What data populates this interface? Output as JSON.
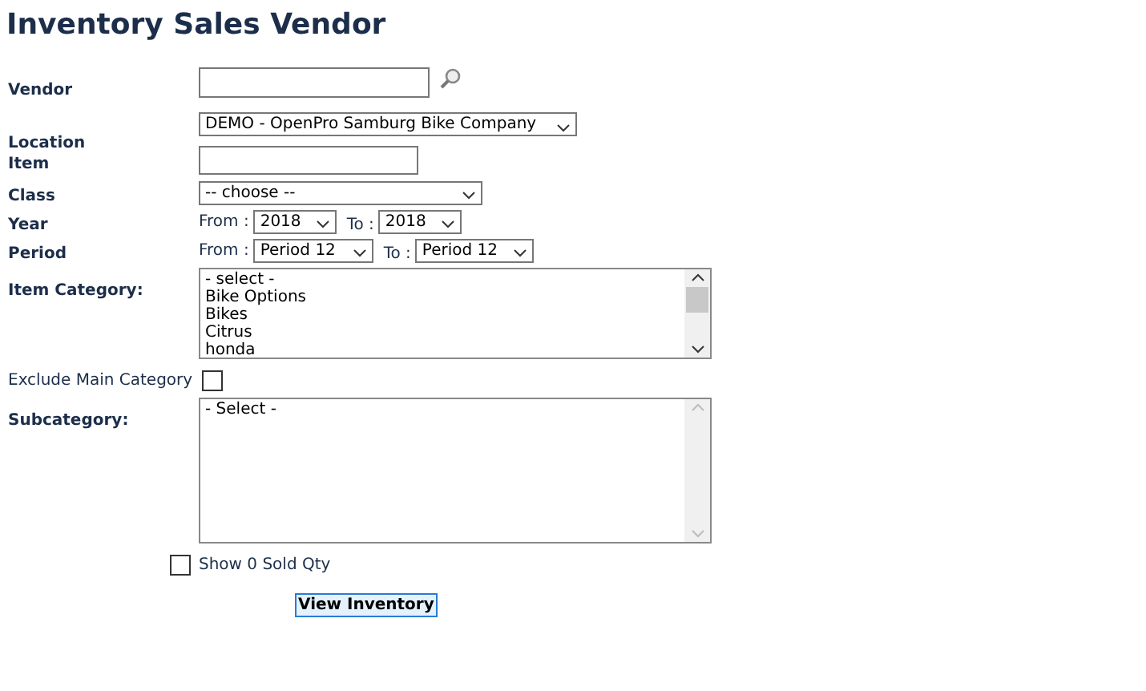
{
  "title": "Inventory Sales Vendor",
  "vendor": {
    "label": "Vendor"
  },
  "location": {
    "label": "Location",
    "value": "DEMO - OpenPro Samburg Bike Company"
  },
  "item": {
    "label": "Item"
  },
  "class": {
    "label": "Class",
    "value": "-- choose --"
  },
  "year": {
    "label": "Year",
    "from_label": "From :",
    "from": "2018",
    "to_label": "To :",
    "to": "2018"
  },
  "period": {
    "label": "Period",
    "from_label": "From :",
    "from": "Period 12",
    "to_label": "To :",
    "to": "Period 12"
  },
  "item_category": {
    "label": "Item Category:",
    "options": [
      "- select -",
      "Bike Options",
      "Bikes",
      "Citrus",
      "honda"
    ]
  },
  "exclude_main_category": {
    "label": "Exclude Main Category",
    "checked": false
  },
  "subcategory": {
    "label": "Subcategory:",
    "options": [
      "- Select -"
    ]
  },
  "show_zero_sold": {
    "label": "Show 0 Sold Qty",
    "checked": false
  },
  "button": "View Inventory"
}
